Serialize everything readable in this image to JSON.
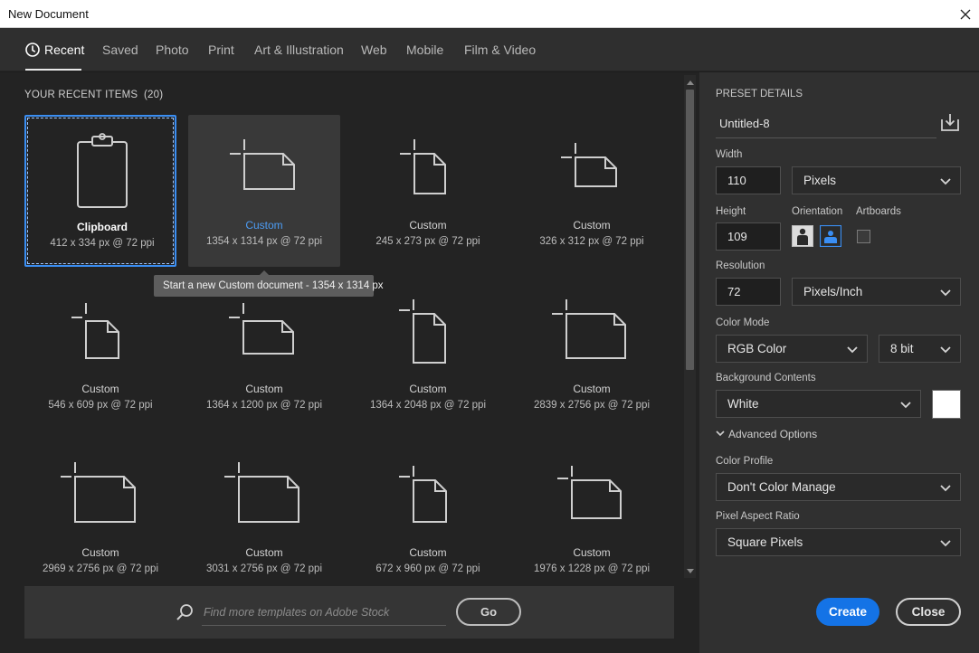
{
  "window": {
    "title": "New Document"
  },
  "tabs": [
    "Recent",
    "Saved",
    "Photo",
    "Print",
    "Art & Illustration",
    "Web",
    "Mobile",
    "Film & Video"
  ],
  "recent": {
    "heading": "YOUR RECENT ITEMS",
    "count": "(20)",
    "items": [
      {
        "name": "Clipboard",
        "size": "412 x 334 px @ 72 ppi"
      },
      {
        "name": "Custom",
        "size": "1354 x 1314 px @ 72 ppi"
      },
      {
        "name": "Custom",
        "size": "245 x 273 px @ 72 ppi"
      },
      {
        "name": "Custom",
        "size": "326 x 312 px @ 72 ppi"
      },
      {
        "name": "Custom",
        "size": "546 x 609 px @ 72 ppi"
      },
      {
        "name": "Custom",
        "size": "1364 x 1200 px @ 72 ppi"
      },
      {
        "name": "Custom",
        "size": "1364 x 2048 px @ 72 ppi"
      },
      {
        "name": "Custom",
        "size": "2839 x 2756 px @ 72 ppi"
      },
      {
        "name": "Custom",
        "size": "2969 x 2756 px @ 72 ppi"
      },
      {
        "name": "Custom",
        "size": "3031 x 2756 px @ 72 ppi"
      },
      {
        "name": "Custom",
        "size": "672 x 960 px @ 72 ppi"
      },
      {
        "name": "Custom",
        "size": "1976 x 1228 px @ 72 ppi"
      }
    ],
    "tooltip": "Start a new Custom document - 1354 x 1314 px"
  },
  "stock": {
    "placeholder": "Find more templates on Adobe Stock",
    "go_label": "Go"
  },
  "preset": {
    "section_label": "PRESET DETAILS",
    "name": "Untitled-8",
    "width_label": "Width",
    "width_value": "110",
    "width_unit": "Pixels",
    "height_label": "Height",
    "height_value": "109",
    "orientation_label": "Orientation",
    "artboards_label": "Artboards",
    "resolution_label": "Resolution",
    "resolution_value": "72",
    "resolution_unit": "Pixels/Inch",
    "color_mode_label": "Color Mode",
    "color_mode": "RGB Color",
    "bit_depth": "8 bit",
    "background_label": "Background Contents",
    "background": "White",
    "background_color": "#ffffff",
    "advanced_label": "Advanced Options",
    "color_profile_label": "Color Profile",
    "color_profile": "Don't Color Manage",
    "pixel_aspect_label": "Pixel Aspect Ratio",
    "pixel_aspect": "Square Pixels",
    "create_label": "Create",
    "close_label": "Close"
  },
  "colors": {
    "accent": "#1473e6",
    "selection": "#3a8ef3",
    "link": "#4c9cf4"
  }
}
